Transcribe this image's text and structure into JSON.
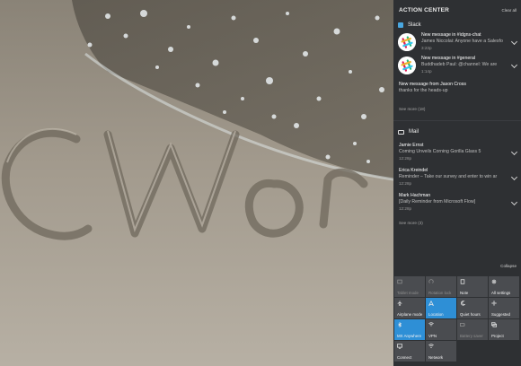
{
  "action_center": {
    "title": "ACTION CENTER",
    "clear_all": "Clear all",
    "groups": [
      {
        "app": "Slack",
        "icon": "slack-icon",
        "notifications": [
          {
            "title": "New message in #idgns-chat",
            "body": "James Niccolai: Anyone have a Salesfo",
            "time": "3:23p"
          },
          {
            "title": "New message in #general",
            "body": "Buddhadeb Paul: @channel: We are",
            "time": "1:14p"
          },
          {
            "title": "New message from Jason Cross",
            "body": "thanks for the heads-up",
            "time": ""
          }
        ],
        "see_more": "See more (18)"
      },
      {
        "app": "Mail",
        "icon": "mail-icon",
        "notifications": [
          {
            "title": "Jamie Ernst",
            "body": "Coming Unveils Corning Gorilla Glass 5",
            "time": "12:28p"
          },
          {
            "title": "Erica Kreindel",
            "body": "Reminder – Take our survey and enter to win ar",
            "time": "12:28p"
          },
          {
            "title": "Mark Hachman",
            "body": "[Daily Reminder from Microsoft Flow]",
            "time": "12:28p"
          }
        ],
        "see_more": "See more (3)"
      }
    ],
    "collapse": "Collapse",
    "quick_actions": [
      {
        "label": "Tablet mode",
        "icon": "tablet-mode-icon",
        "state": "dim"
      },
      {
        "label": "Rotation lock",
        "icon": "rotation-lock-icon",
        "state": "dim"
      },
      {
        "label": "Note",
        "icon": "note-icon",
        "state": "off"
      },
      {
        "label": "All settings",
        "icon": "gear-icon",
        "state": "off"
      },
      {
        "label": "Airplane mode",
        "icon": "airplane-icon",
        "state": "off"
      },
      {
        "label": "Location",
        "icon": "location-icon",
        "state": "on"
      },
      {
        "label": "Quiet hours",
        "icon": "moon-icon",
        "state": "off"
      },
      {
        "label": "Suggested",
        "icon": "brightness-icon",
        "state": "off"
      },
      {
        "label": "MX Anywhere",
        "icon": "bluetooth-icon",
        "state": "on"
      },
      {
        "label": "VPN",
        "icon": "vpn-icon",
        "state": "off"
      },
      {
        "label": "Battery saver",
        "icon": "battery-icon",
        "state": "dim"
      },
      {
        "label": "Project",
        "icon": "project-icon",
        "state": "off"
      },
      {
        "label": "Connect",
        "icon": "connect-icon",
        "state": "off"
      },
      {
        "label": "Network",
        "icon": "network-icon",
        "state": "off"
      }
    ]
  },
  "colors": {
    "accent": "#2e8fd6",
    "panel": "#1c1e22",
    "tile": "#4a4c50"
  }
}
